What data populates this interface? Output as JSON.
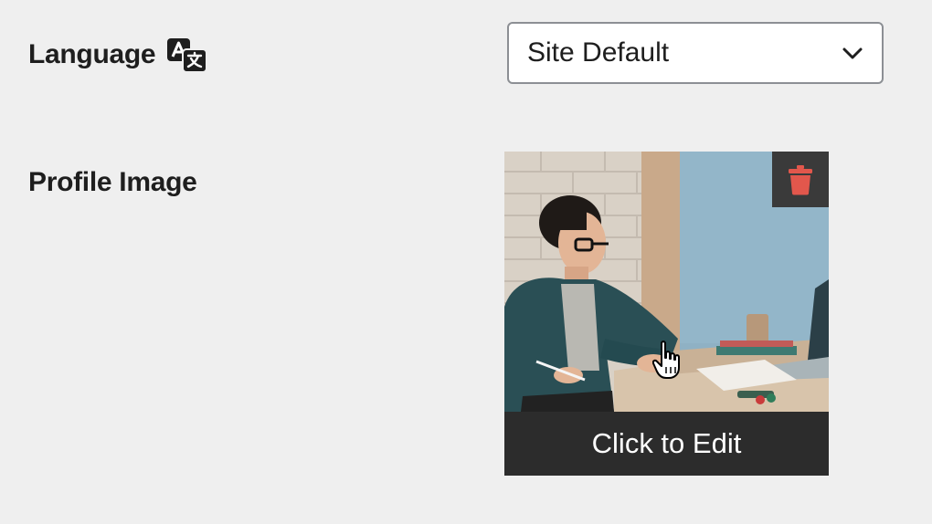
{
  "settings": {
    "language": {
      "label": "Language",
      "icon": "translate-icon",
      "selected": "Site Default"
    },
    "profile_image": {
      "label": "Profile Image",
      "edit_label": "Click to Edit",
      "delete_icon": "trash-icon"
    }
  },
  "colors": {
    "background": "#efefef",
    "select_border": "#8c8f94",
    "edit_bar": "#2c2c2c",
    "delete_button_bg": "#3a3a3a",
    "delete_icon": "#e2574c"
  }
}
